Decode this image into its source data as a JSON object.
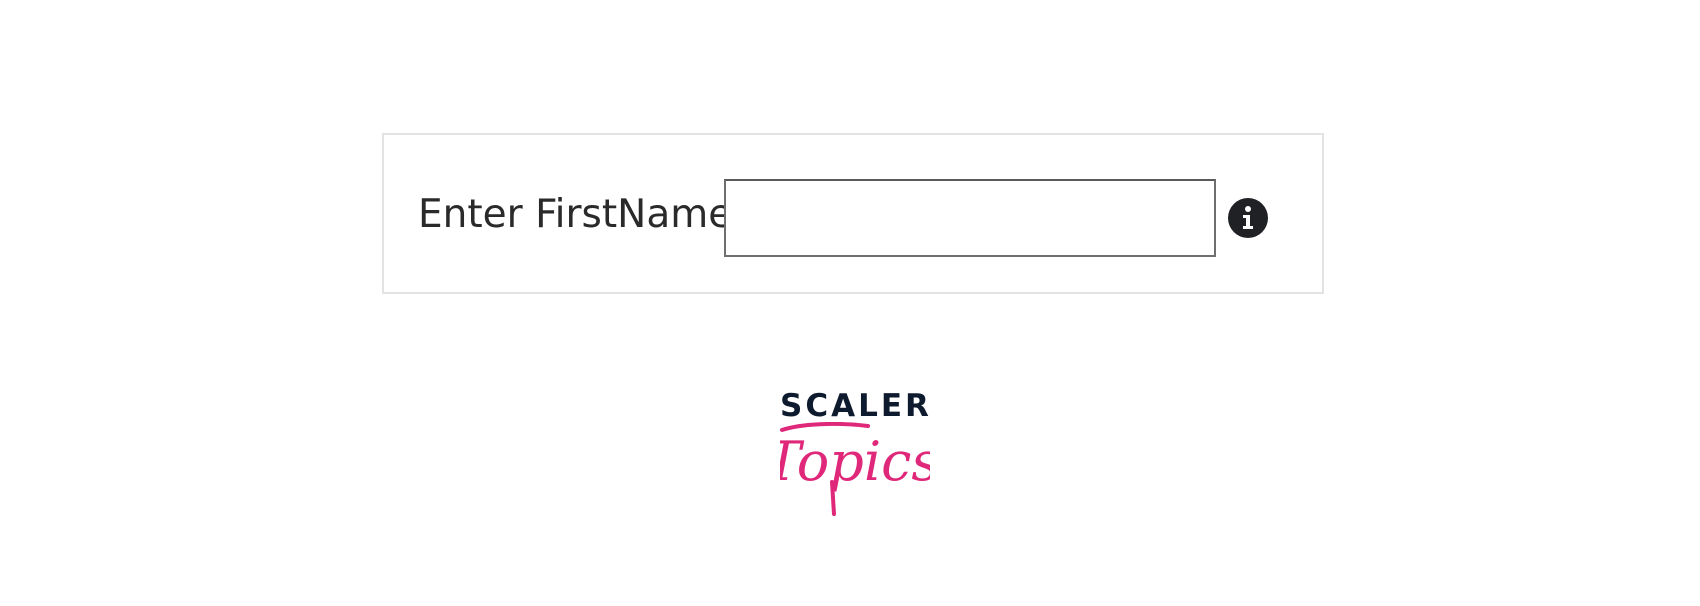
{
  "form": {
    "label": "Enter FirstName",
    "input_value": "",
    "input_placeholder": "",
    "info_icon": "info-icon"
  },
  "logo": {
    "top_text": "SCALER",
    "script_text": "Topics",
    "colors": {
      "top": "#0e1a2e",
      "script": "#e0287a"
    }
  }
}
